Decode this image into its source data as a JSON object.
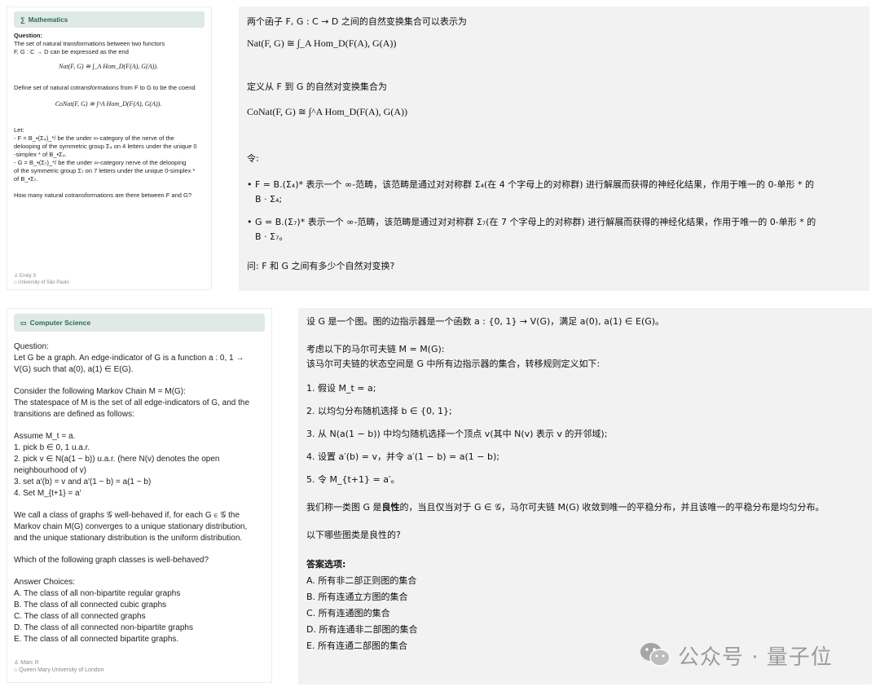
{
  "math": {
    "tag": "Mathematics",
    "question_label": "Question:",
    "q1": "The set of natural transformations between two functors",
    "q2": "F, G : C → D can be expressed as the end",
    "eq1": "Nat(F, G) ≅ ∫_A Hom_D(F(A), G(A)).",
    "q3": "Define set of natural cotransformations from F to G to be the coend",
    "eq2": "CoNat(F, G) ≅ ∫^A Hom_D(F(A), G(A)).",
    "let": "Let:",
    "l1": "- F = B_•(Σ₄)_*/ be the under ∞-category of the nerve of the",
    "l2": "delooping of the symmetric group Σ₄ on 4 letters under the unique 0",
    "l3": "-simplex * of B_•Σ₄.",
    "l4": "- G = B_•(Σ₇)_*/ be the under ∞-category nerve of the delooping",
    "l5": "of the symmetric group Σ₇ on 7 letters under the unique 0-simplex *",
    "l6": "of B_•Σ₇.",
    "ask": "How many natural cotransformations are there between F and G?",
    "author": "Emily S",
    "affil": "University of São Paulo"
  },
  "math_zh": {
    "p1": "两个函子 F, G : C → D 之间的自然变换集合可以表示为",
    "eq1": "Nat(F, G) ≅ ∫_A Hom_D(F(A), G(A))",
    "p2": "定义从 F 到 G 的自然对变换集合为",
    "eq2": "CoNat(F, G) ≅ ∫^A Hom_D(F(A), G(A))",
    "p3": "令:",
    "b1a": "• F = B.(Σ₄)* 表示一个 ∞-范畴，该范畴是通过对对称群 Σ₄(在 4 个字母上的对称群) 进行解展而获得的神经化结果，作用于唯一的 0-单形 * 的",
    "b1b": "B · Σ₄;",
    "b2a": "• G = B.(Σ₇)* 表示一个 ∞-范畴，该范畴是通过对对称群 Σ₇(在 7 个字母上的对称群) 进行解展而获得的神经化结果，作用于唯一的 0-单形 * 的",
    "b2b": "B · Σ₇。",
    "p4": "问: F 和 G 之间有多少个自然对变换?"
  },
  "cs": {
    "tag": "Computer Science",
    "question_label": "Question:",
    "q1": "Let G be a graph. An edge-indicator of G is a function a : 0, 1 →",
    "q2": "V(G) such that a(0), a(1) ∈ E(G).",
    "q3": "Consider the following Markov Chain M = M(G):",
    "q4": "The statespace of M is the set of all edge-indicators of G, and the",
    "q5": "transitions are defined as follows:",
    "s0": "Assume M_t = a.",
    "s1": "1. pick b ∈ 0, 1 u.a.r.",
    "s2": "2. pick v ∈ N(a(1 − b)) u.a.r. (here N(v) denotes the open",
    "s2b": "neighbourhood of v)",
    "s3": "3. set a′(b) = v and a′(1 − b) = a(1 − b)",
    "s4": "4. Set M_{t+1} = a′",
    "w1": "We call a class of graphs 𝒢 well-behaved if, for each G ∈ 𝒢 the",
    "w2": "Markov chain M(G) converges to a unique stationary distribution,",
    "w3": "and the unique stationary distribution is the uniform distribution.",
    "ask": "Which of the following graph classes is well-behaved?",
    "choices_label": "Answer Choices:",
    "choices": [
      "A. The class of all non-bipartite regular graphs",
      "B. The class of all connected cubic graphs",
      "C. The class of all connected graphs",
      "D. The class of all connected non-bipartite graphs",
      "E. The class of all connected bipartite graphs."
    ],
    "author": "Marc R",
    "affil": "Queen Mary University of London"
  },
  "cs_zh": {
    "p1": "设 G 是一个图。图的边指示器是一个函数 a : {0, 1} → V(G)，满足 a(0), a(1) ∈ E(G)。",
    "p2": "考虑以下的马尔可夫链 M = M(G):",
    "p3": "该马尔可夫链的状态空间是 G 中所有边指示器的集合，转移规则定义如下:",
    "s1": "1. 假设 M_t = a;",
    "s2": "2. 以均匀分布随机选择 b ∈ {0, 1};",
    "s3": "3. 从 N(a(1 − b)) 中均匀随机选择一个顶点 v(其中 N(v) 表示 v 的开邻域);",
    "s4": "4. 设置 a′(b) = v，并令 a′(1 − b) = a(1 − b);",
    "s5": "5. 令 M_{t+1} = a′。",
    "p4a": "我们称一类图 G 是",
    "p4b": "良性",
    "p4c": "的，当且仅当对于 G ∈ 𝒢，马尔可夫链 M(G) 收敛到唯一的平稳分布，并且该唯一的平稳分布是均匀分布。",
    "p5": "以下哪些图类是良性的?",
    "choices_label": "答案选项:",
    "choices": [
      "A. 所有非二部正则图的集合",
      "B. 所有连通立方图的集合",
      "C. 所有连通图的集合",
      "D. 所有连通非二部图的集合",
      "E. 所有连通二部图的集合"
    ]
  },
  "watermark": {
    "text": "公众号 · 量子位"
  },
  "colors": {
    "tag_bg": "#dfe9e5",
    "tag_text": "#2b6b59",
    "panel_bg": "#f2f2f2",
    "watermark": "#9c9c9c"
  }
}
